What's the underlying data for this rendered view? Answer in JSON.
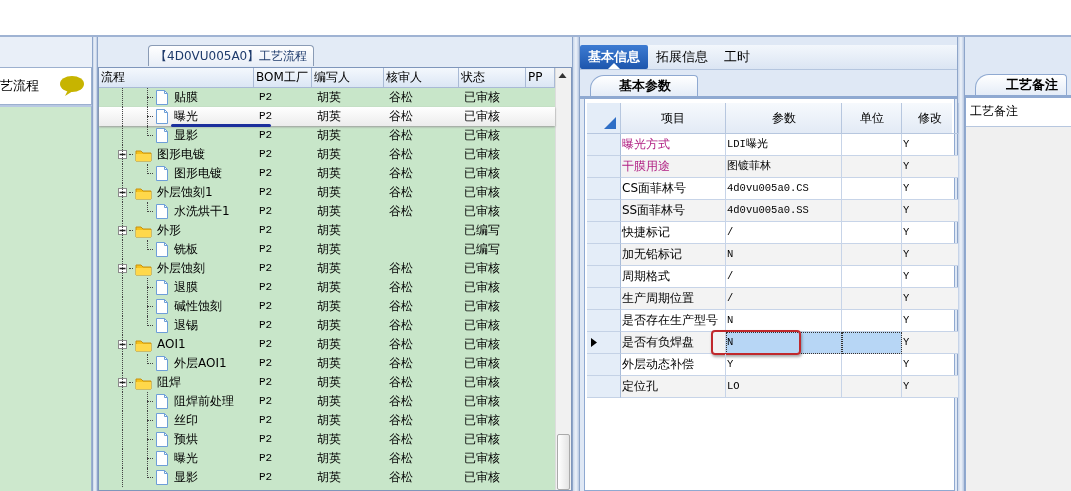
{
  "left_panel": {
    "title": "艺流程"
  },
  "process_tab": {
    "label": "【4D0VU005A0】工艺流程"
  },
  "tree": {
    "columns": [
      "流程",
      "BOM工厂",
      "编写人",
      "核审人",
      "状态",
      "PP"
    ],
    "continued_children": [
      {
        "label": "贴膜",
        "bom_factory": "P2",
        "author": "胡英",
        "reviewer": "谷松",
        "status": "已审核",
        "selected": false,
        "underlined": false
      },
      {
        "label": "曝光",
        "bom_factory": "P2",
        "author": "胡英",
        "reviewer": "谷松",
        "status": "已审核",
        "selected": true,
        "underlined": true
      },
      {
        "label": "显影",
        "bom_factory": "P2",
        "author": "胡英",
        "reviewer": "谷松",
        "status": "已审核",
        "selected": false,
        "underlined": false
      }
    ],
    "nodes": [
      {
        "label": "图形电镀",
        "bom_factory": "P2",
        "author": "胡英",
        "reviewer": "谷松",
        "status": "已审核",
        "selected": false,
        "expanded": true,
        "children": [
          {
            "label": "图形电镀",
            "bom_factory": "P2",
            "author": "胡英",
            "reviewer": "谷松",
            "status": "已审核",
            "selected": false,
            "underlined": false
          }
        ]
      },
      {
        "label": "外层蚀刻1",
        "bom_factory": "P2",
        "author": "胡英",
        "reviewer": "谷松",
        "status": "已审核",
        "selected": false,
        "expanded": true,
        "children": [
          {
            "label": "水洗烘干1",
            "bom_factory": "P2",
            "author": "胡英",
            "reviewer": "谷松",
            "status": "已审核",
            "selected": false,
            "underlined": false
          }
        ]
      },
      {
        "label": "外形",
        "bom_factory": "P2",
        "author": "胡英",
        "status": "已编写",
        "selected": false,
        "expanded": true,
        "children": [
          {
            "label": "铣板",
            "bom_factory": "P2",
            "author": "胡英",
            "status": "已编写",
            "selected": false,
            "underlined": false
          }
        ]
      },
      {
        "label": "外层蚀刻",
        "bom_factory": "P2",
        "author": "胡英",
        "reviewer": "谷松",
        "status": "已审核",
        "selected": false,
        "expanded": true,
        "children": [
          {
            "label": "退膜",
            "bom_factory": "P2",
            "author": "胡英",
            "reviewer": "谷松",
            "status": "已审核",
            "selected": false,
            "underlined": false
          },
          {
            "label": "碱性蚀刻",
            "bom_factory": "P2",
            "author": "胡英",
            "reviewer": "谷松",
            "status": "已审核",
            "selected": false,
            "underlined": false
          },
          {
            "label": "退锡",
            "bom_factory": "P2",
            "author": "胡英",
            "reviewer": "谷松",
            "status": "已审核",
            "selected": false,
            "underlined": false
          }
        ]
      },
      {
        "label": "AOI1",
        "bom_factory": "P2",
        "author": "胡英",
        "reviewer": "谷松",
        "status": "已审核",
        "selected": false,
        "expanded": true,
        "children": [
          {
            "label": "外层AOI1",
            "bom_factory": "P2",
            "author": "胡英",
            "reviewer": "谷松",
            "status": "已审核",
            "selected": false,
            "underlined": false
          }
        ]
      },
      {
        "label": "阻焊",
        "bom_factory": "P2",
        "author": "胡英",
        "reviewer": "谷松",
        "status": "已审核",
        "selected": false,
        "expanded": true,
        "children": [
          {
            "label": "阻焊前处理",
            "bom_factory": "P2",
            "author": "胡英",
            "reviewer": "谷松",
            "status": "已审核",
            "selected": false,
            "underlined": false
          },
          {
            "label": "丝印",
            "bom_factory": "P2",
            "author": "胡英",
            "reviewer": "谷松",
            "status": "已审核",
            "selected": false,
            "underlined": false
          },
          {
            "label": "预烘",
            "bom_factory": "P2",
            "author": "胡英",
            "reviewer": "谷松",
            "status": "已审核",
            "selected": false,
            "underlined": false
          },
          {
            "label": "曝光",
            "bom_factory": "P2",
            "author": "胡英",
            "reviewer": "谷松",
            "status": "已审核",
            "selected": false,
            "underlined": false
          },
          {
            "label": "显影",
            "bom_factory": "P2",
            "author": "胡英",
            "reviewer": "谷松",
            "status": "已审核",
            "selected": false,
            "underlined": false
          }
        ]
      }
    ]
  },
  "tabs": [
    {
      "label": "基本信息",
      "selected": true
    },
    {
      "label": "拓展信息",
      "selected": false
    },
    {
      "label": "工时",
      "selected": false
    }
  ],
  "sub_tab": {
    "label": "基本参数"
  },
  "params": {
    "columns": [
      "项目",
      "参数",
      "单位",
      "修改"
    ],
    "rows": [
      {
        "item": "曝光方式",
        "value": "LDI曝光",
        "modified": "Y",
        "required": true,
        "selected": false,
        "circled": false
      },
      {
        "item": "干膜用途",
        "value": "图镀菲林",
        "modified": "Y",
        "required": true,
        "selected": false,
        "circled": false
      },
      {
        "item": "CS面菲林号",
        "value": "4d0vu005a0.CS",
        "modified": "Y",
        "required": false,
        "selected": false,
        "circled": false
      },
      {
        "item": "SS面菲林号",
        "value": "4d0vu005a0.SS",
        "modified": "Y",
        "required": false,
        "selected": false,
        "circled": false
      },
      {
        "item": "快捷标记",
        "value": "/",
        "modified": "Y",
        "required": false,
        "selected": false,
        "circled": false
      },
      {
        "item": "加无铅标记",
        "value": "N",
        "modified": "Y",
        "required": false,
        "selected": false,
        "circled": false
      },
      {
        "item": "周期格式",
        "value": "/",
        "modified": "Y",
        "required": false,
        "selected": false,
        "circled": false
      },
      {
        "item": "生产周期位置",
        "value": "/",
        "modified": "Y",
        "required": false,
        "selected": false,
        "circled": false
      },
      {
        "item": "是否存在生产型号",
        "value": "N",
        "modified": "Y",
        "required": false,
        "selected": false,
        "circled": false
      },
      {
        "item": "是否有负焊盘",
        "value": "N",
        "modified": "Y",
        "required": false,
        "selected": true,
        "circled": true
      },
      {
        "item": "外层动态补偿",
        "value": "Y",
        "modified": "Y",
        "required": false,
        "selected": false,
        "circled": false
      },
      {
        "item": "定位孔",
        "value": "LO",
        "modified": "Y",
        "required": false,
        "selected": false,
        "circled": false
      }
    ]
  },
  "notes_panel": {
    "tab": "工艺备注",
    "header": "工艺备注"
  }
}
